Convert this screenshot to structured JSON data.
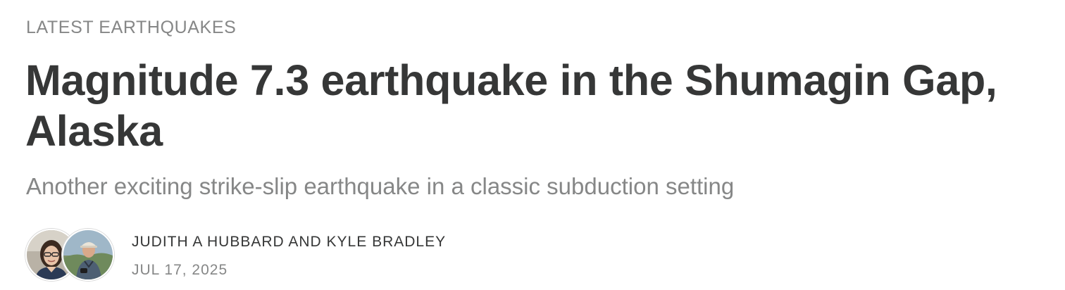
{
  "section": {
    "label": "LATEST EARTHQUAKES"
  },
  "post": {
    "title": "Magnitude 7.3 earthquake in the Shumagin Gap, Alaska",
    "subtitle": "Another exciting strike-slip earthquake in a classic subduction setting",
    "authors": "JUDITH A HUBBARD AND KYLE BRADLEY",
    "date": "JUL 17, 2025"
  },
  "avatars": [
    {
      "icon": "author-photo-icon"
    },
    {
      "icon": "author-photo-icon"
    }
  ]
}
